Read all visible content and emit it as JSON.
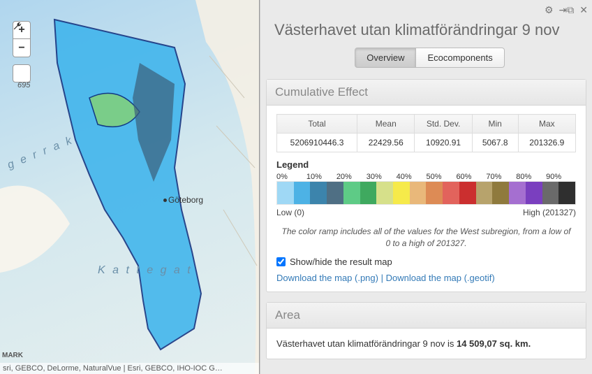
{
  "panel": {
    "title": "Västerhavet utan klimatförändringar 9 nov",
    "tabs": {
      "overview": "Overview",
      "eco": "Ecocomponents"
    },
    "icons": {
      "gear": "gear-icon",
      "export": "export-icon",
      "close": "close-icon"
    }
  },
  "map": {
    "scale": "695",
    "sea1": "g  e  r  r  a  k",
    "sea2": "K a t t e g a t",
    "city": "Göteborg",
    "country": "MARK",
    "attribution": "sri, GEBCO, DeLorme, NaturalVue | Esri, GEBCO, IHO-IOC G…"
  },
  "cumulative": {
    "heading": "Cumulative Effect",
    "headers": [
      "Total",
      "Mean",
      "Std. Dev.",
      "Min",
      "Max"
    ],
    "values": [
      "5206910446.3",
      "22429.56",
      "10920.91",
      "5067.8",
      "201326.9"
    ],
    "legend_title": "Legend",
    "percent_labels": [
      "0%",
      "10%",
      "20%",
      "30%",
      "40%",
      "50%",
      "60%",
      "70%",
      "80%",
      "90%"
    ],
    "ramp_colors": [
      "#9fd8f5",
      "#4db2e5",
      "#3c84ac",
      "#4f6f84",
      "#5ecb86",
      "#3fa95f",
      "#d6e08a",
      "#f6ea4a",
      "#e9b87a",
      "#dd8b55",
      "#e2635c",
      "#cb2f2f",
      "#b7a36c",
      "#8f7a3d",
      "#a56fd0",
      "#7a3fbf",
      "#6a6a6a",
      "#2f2f2f"
    ],
    "low_label": "Low (0)",
    "high_label": "High (201327)",
    "note": "The color ramp includes all of the values for the West subregion, from a low of 0 to a high of 201327.",
    "checkbox_label": "Show/hide the result map",
    "link_png": "Download the map (.png)",
    "link_sep": " | ",
    "link_geotif": "Download the map (.geotif)"
  },
  "area": {
    "heading": "Area",
    "prefix": "Västerhavet utan klimatförändringar 9 nov is ",
    "value": "14 509,07 sq. km."
  }
}
